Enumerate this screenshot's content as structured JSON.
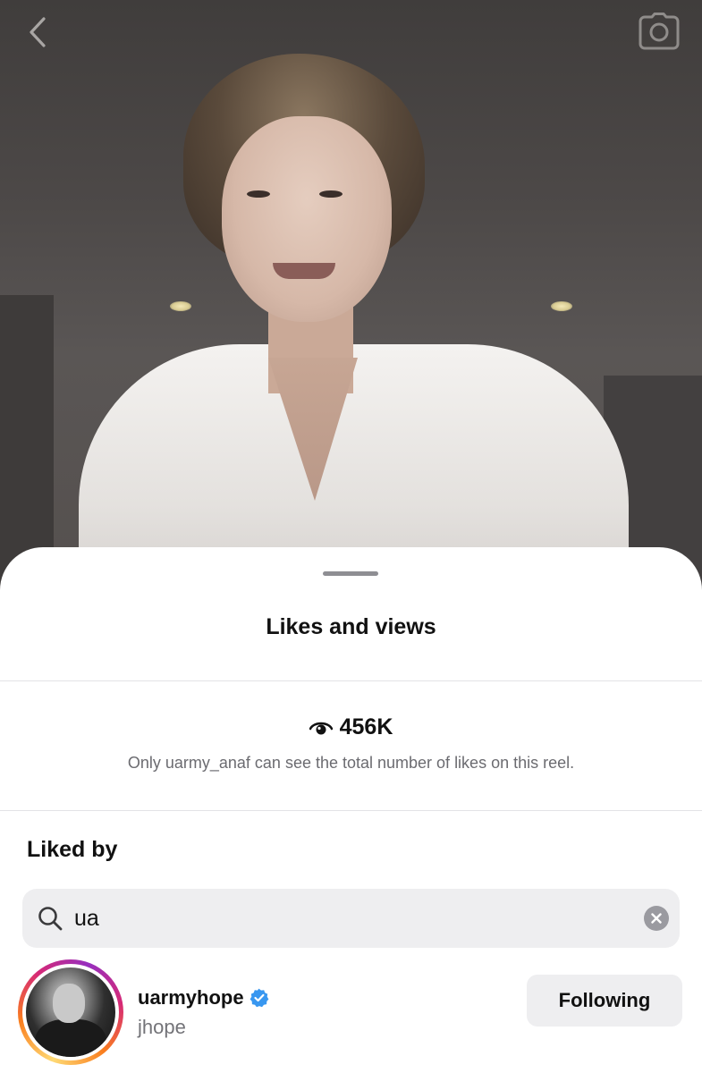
{
  "sheet": {
    "title": "Likes and views"
  },
  "views": {
    "icon": "eye-icon",
    "count": "456K",
    "note": "Only uarmy_anaf can see the total number of likes on this reel."
  },
  "liked_by": {
    "heading": "Liked by",
    "search": {
      "value": "ua",
      "icon": "search-icon",
      "clear_icon": "clear-icon"
    },
    "users": [
      {
        "username": "uarmyhope",
        "verified": true,
        "full_name": "jhope",
        "button_label": "Following"
      }
    ]
  },
  "top_bar": {
    "back_icon": "chevron-left-icon",
    "camera_icon": "camera-icon"
  },
  "colors": {
    "verified_blue": "#3897f0",
    "sheet_bg": "#ffffff",
    "secondary_text": "#737378",
    "input_bg": "#eeeef0"
  }
}
